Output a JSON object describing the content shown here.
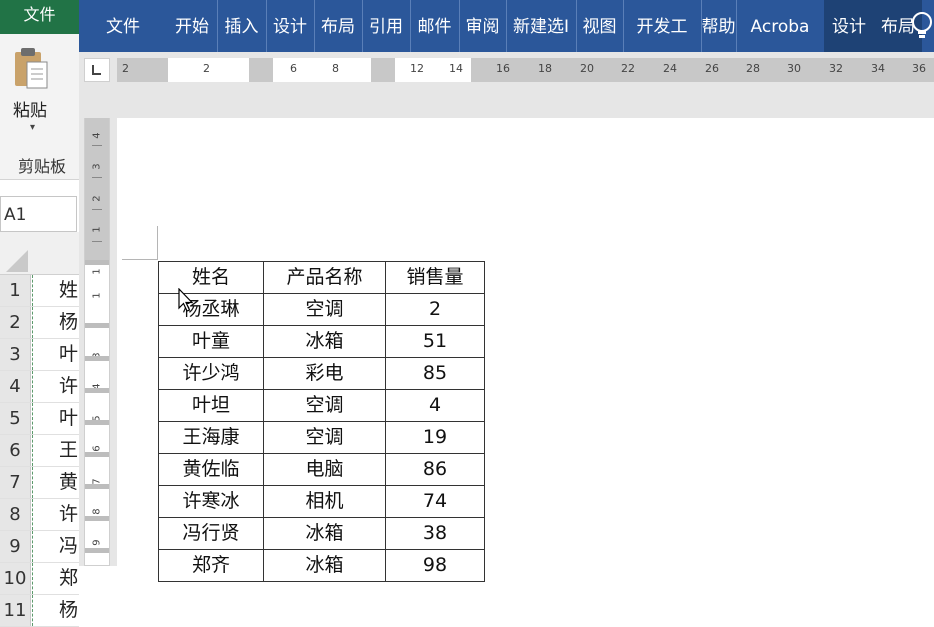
{
  "excel": {
    "file_tab": "文件",
    "paste_label": "粘贴",
    "paste_arrow": "▾",
    "clipboard_group": "剪贴板",
    "name_box": "A1",
    "rows": [
      {
        "num": "1",
        "cell": "姓"
      },
      {
        "num": "2",
        "cell": "杨"
      },
      {
        "num": "3",
        "cell": "叶"
      },
      {
        "num": "4",
        "cell": "许"
      },
      {
        "num": "5",
        "cell": "叶"
      },
      {
        "num": "6",
        "cell": "王"
      },
      {
        "num": "7",
        "cell": "黄"
      },
      {
        "num": "8",
        "cell": "许"
      },
      {
        "num": "9",
        "cell": "冯"
      },
      {
        "num": "10",
        "cell": "郑"
      },
      {
        "num": "11",
        "cell": "杨"
      }
    ]
  },
  "word": {
    "tabs": [
      "文件",
      "开始",
      "插入",
      "设计",
      "布局",
      "引用",
      "邮件",
      "审阅",
      "新建选I",
      "视图",
      "开发工",
      "帮助",
      "Acroba",
      "设计",
      "布局"
    ],
    "ruler_numbers": [
      "2",
      "2",
      "6",
      "8",
      "12",
      "14",
      "16",
      "18",
      "20",
      "22",
      "24",
      "26",
      "28",
      "30",
      "32",
      "34",
      "36"
    ],
    "vertical_ruler_numbers": [
      "4",
      "3",
      "2",
      "1",
      "1",
      "1",
      "2",
      "3",
      "4",
      "5",
      "6",
      "7",
      "8",
      "9"
    ],
    "table": {
      "headers": [
        "姓名",
        "产品名称",
        "销售量"
      ],
      "rows": [
        [
          "杨丞琳",
          "空调",
          "2"
        ],
        [
          "叶童",
          "冰箱",
          "51"
        ],
        [
          "许少鸿",
          "彩电",
          "85"
        ],
        [
          "叶坦",
          "空调",
          "4"
        ],
        [
          "王海康",
          "空调",
          "19"
        ],
        [
          "黄佐临",
          "电脑",
          "86"
        ],
        [
          "许寒冰",
          "相机",
          "74"
        ],
        [
          "冯行贤",
          "冰箱",
          "38"
        ],
        [
          "郑齐",
          "冰箱",
          "98"
        ]
      ]
    }
  },
  "icons": {
    "paste": "clipboard-paste-icon",
    "lightbulb": "lightbulb-icon",
    "cursor": "mouse-pointer-icon",
    "tab_marker": "tab-stop-icon"
  },
  "colors": {
    "excel_green": "#217346",
    "word_blue": "#2b579a",
    "word_context_tab": "#1e4275"
  }
}
